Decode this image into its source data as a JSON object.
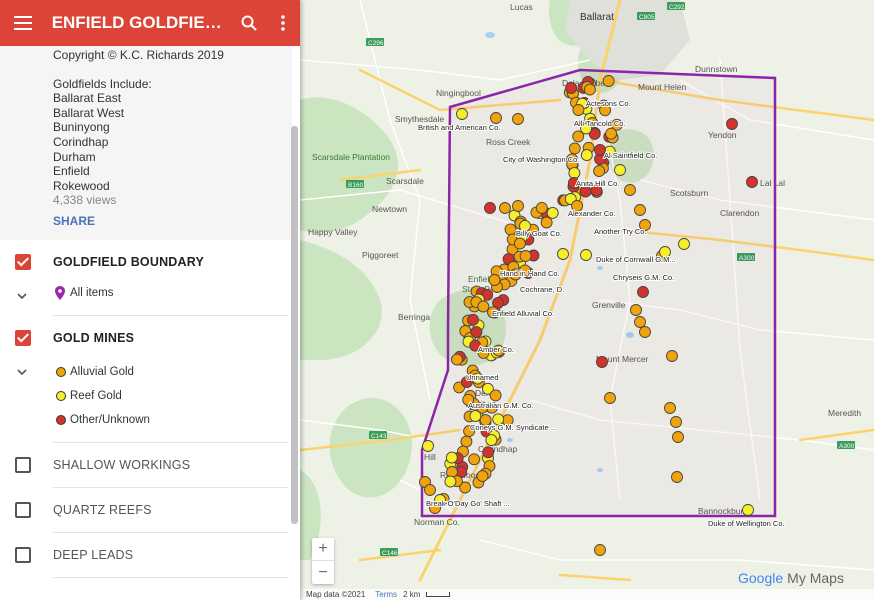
{
  "header": {
    "title": "ENFIELD GOLDFIELD DI...",
    "menu_icon": "hamburger-menu-icon",
    "search_icon": "search-icon",
    "more_icon": "more-vert-icon",
    "color": "#db4437"
  },
  "description": {
    "copyright": "Copyright © K.C. Richards 2019",
    "goldfields_heading": "Goldfields Include:",
    "goldfields": [
      "Ballarat East",
      "Ballarat West",
      "Buninyong",
      "Corindhap",
      "Durham",
      "Enfield",
      "Rokewood"
    ],
    "views": "4,338 views",
    "share_label": "SHARE"
  },
  "layers": [
    {
      "name": "GOLDFIELD BOUNDARY",
      "checked": true,
      "legend": [
        {
          "label": "All items",
          "icon": "map-pin-icon",
          "color": "#9c27b0"
        }
      ]
    },
    {
      "name": "GOLD MINES",
      "checked": true,
      "legend": [
        {
          "label": "Alluvial Gold",
          "color": "#f0a30a"
        },
        {
          "label": "Reef Gold",
          "color": "#f7ee2a"
        },
        {
          "label": "Other/Unknown",
          "color": "#d0342c"
        }
      ]
    },
    {
      "name": "SHALLOW WORKINGS",
      "checked": false
    },
    {
      "name": "QUARTZ REEFS",
      "checked": false
    },
    {
      "name": "DEEP LEADS",
      "checked": false
    }
  ],
  "map": {
    "towns": [
      "Ballarat",
      "Lucas",
      "Dunnstown",
      "Smythesdale",
      "Ross Creek",
      "Scarsdale",
      "Newtown",
      "Piggoreet",
      "Berringa",
      "Happy Valley",
      "Enfield",
      "State Park",
      "Grenville",
      "Delacombe",
      "Mount Helen",
      "Yendon",
      "Lal Lal",
      "Scotsburn",
      "Clarendon",
      "Mount Mercer",
      "Meredith",
      "Dereel",
      "Rokewood",
      "Norman Co.",
      "Bannockburn",
      "Ningingbool",
      "Scarsdale Plantation",
      "Hill",
      "Corindhap"
    ],
    "roads": [
      "C292",
      "C805",
      "C296",
      "B160",
      "A300",
      "C143",
      "C146"
    ],
    "mine_labels": [
      "Actesons Co.",
      "British and American Co.",
      "City of Washington Co.",
      "Alexander Co.",
      "Another Try Co.",
      "Billy Goat Co.",
      "Duke of Cornwall G.M...",
      "Chryseis G.M. Co.",
      "Hand in Hand Co.",
      "Cochrane, D.",
      "Enfield Alluvial Co.",
      "Amber Co.",
      "Unnamed",
      "Australian G.M. Co.",
      "Coneys G.M. Syndicate ...",
      "Break O'Day Go' Shaft ...",
      "Duke of Wellington Co.",
      "Anita Hill Co.",
      "Al Saintfield Co.",
      "Alli Tancold Co."
    ],
    "boundary_color": "#8e24aa",
    "legend_colors": {
      "alluvial": "#f0a30a",
      "reef": "#f7ee2a",
      "other": "#d0342c"
    },
    "zoom_in": "+",
    "zoom_out": "−"
  },
  "footer": {
    "map_data": "Map data ©2021",
    "terms": "Terms",
    "scale": "2 km"
  },
  "logo": {
    "google": "Google",
    "mymaps": "My Maps"
  }
}
